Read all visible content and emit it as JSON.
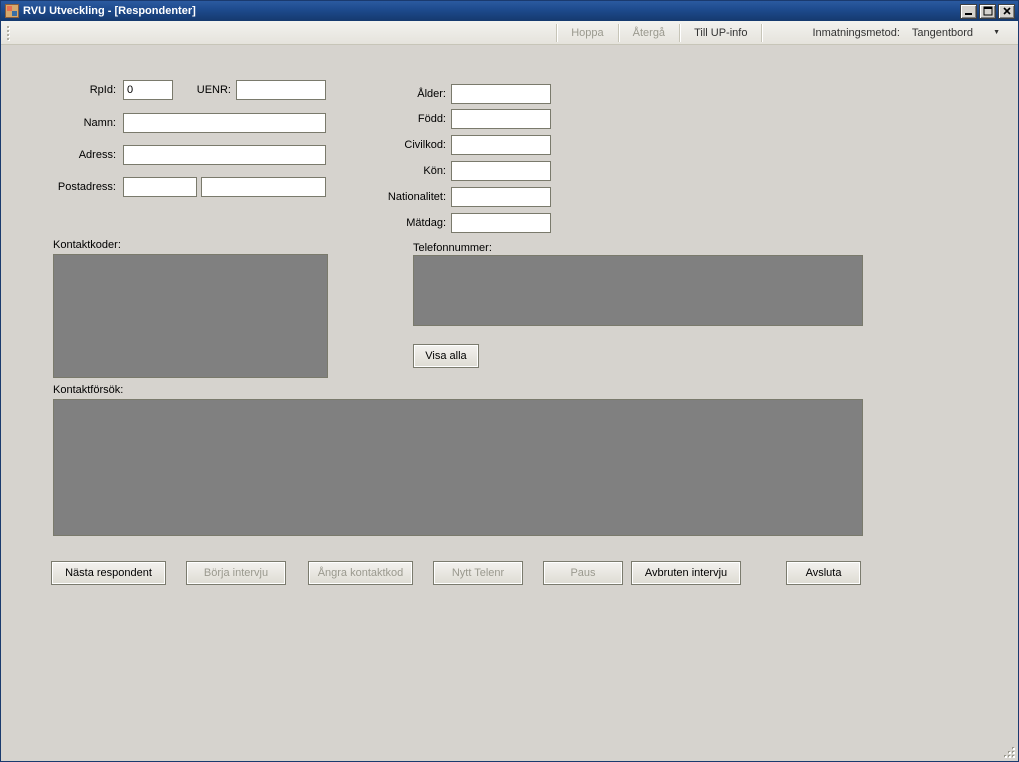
{
  "titlebar": {
    "app_name": "RVU Utveckling",
    "document": "[Respondenter]"
  },
  "toolbar": {
    "hoppa": "Hoppa",
    "aterga": "Återgå",
    "till_up_info": "Till UP-info",
    "inmatning_label": "Inmatningsmetod:",
    "inmatning_value": "Tangentbord"
  },
  "left": {
    "rpid_label": "RpId:",
    "rpid_value": "0",
    "uenr_label": "UENR:",
    "uenr_value": "",
    "namn_label": "Namn:",
    "namn_value": "",
    "adress_label": "Adress:",
    "adress_value": "",
    "postadress_label": "Postadress:",
    "post1_value": "",
    "post2_value": "",
    "kontaktkoder_label": "Kontaktkoder:",
    "kontaktforsok_label": "Kontaktförsök:"
  },
  "right": {
    "alder_label": "Ålder:",
    "alder_value": "",
    "fodd_label": "Född:",
    "fodd_value": "",
    "civilkod_label": "Civilkod:",
    "civilkod_value": "",
    "kon_label": "Kön:",
    "kon_value": "",
    "nationalitet_label": "Nationalitet:",
    "nationalitet_value": "",
    "matdag_label": "Mätdag:",
    "matdag_value": "",
    "telefon_label": "Telefonnummer:",
    "visa_alla": "Visa alla"
  },
  "buttons": {
    "nasta": "Nästa respondent",
    "borja": "Börja intervju",
    "angra": "Ångra kontaktkod",
    "nytt": "Nytt Telenr",
    "paus": "Paus",
    "avbruten": "Avbruten intervju",
    "avsluta": "Avsluta"
  }
}
